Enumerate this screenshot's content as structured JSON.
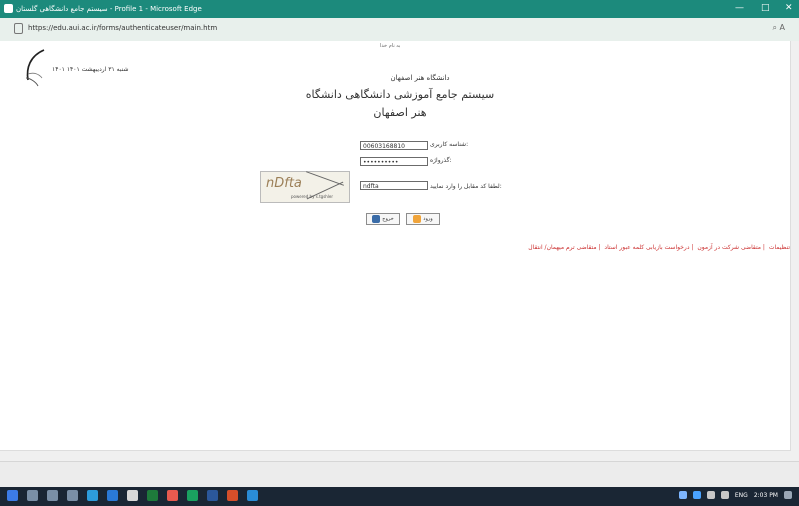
{
  "browser": {
    "title": "سیستم جامع دانشگاهی گلستان - Profile 1 - Microsoft Edge",
    "url": "https://edu.aui.ac.ir/forms/authenticateuser/main.htm",
    "controls": {
      "minimize": "—",
      "maximize": "□",
      "close": "✕"
    },
    "toolbar_icons": "⌕  A"
  },
  "page": {
    "welcome": "به نام خدا",
    "date": "۱۴۰۱ شنبه ۳۱ اردیبهشت ۱۴۰۱",
    "university": "دانشگاه هنر اصفهان",
    "system_title": "سیستم جامع آموزشی دانشگاهی دانشگاه هنر اصفهان",
    "username_label": "شناسه کاربری:",
    "username_value": "00603168810",
    "password_label": "گذرواژه:",
    "password_value": "••••••••••",
    "captcha_label": "لطفا کد مقابل را وارد نمایید:",
    "captcha_value": "ndfta",
    "captcha_image_text": "nDfta",
    "captcha_powered": "powered by s.tgshler",
    "login_button": "ورود",
    "exit_button": "خروج",
    "links": [
      "تنظیمات",
      "متقاضی شرکت در آزمون",
      "درخواست بازیابی کلمه عبور استاد",
      "متقاضی ترم میهمان/ انتقال"
    ]
  },
  "taskbar": {
    "language": "ENG",
    "time": "2:03 PM"
  },
  "colors": {
    "titlebar": "#1c8a7c",
    "taskbar": "#1a2634",
    "link_red": "#c33"
  }
}
